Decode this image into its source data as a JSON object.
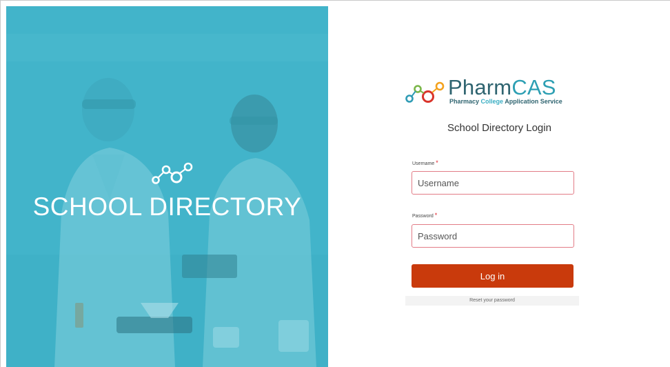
{
  "hero": {
    "title": "SCHOOL DIRECTORY",
    "logo_icon": "molecule-icon"
  },
  "brand": {
    "name_part1": "Pharm",
    "name_part2": "CAS",
    "tagline_part1": "Pharmacy ",
    "tagline_part2": "College",
    "tagline_part3": " Application Service",
    "logo_icon": "molecule-icon",
    "colors": {
      "ring_orange": "#f4a21d",
      "ring_green": "#7ab648",
      "ring_red": "#d9342b",
      "ring_teal": "#2f9cb5"
    }
  },
  "login": {
    "heading": "School Directory Login",
    "username": {
      "label": "Username",
      "required_marker": "*",
      "placeholder": "Username",
      "value": ""
    },
    "password": {
      "label": "Password",
      "required_marker": "*",
      "placeholder": "Password",
      "value": ""
    },
    "submit_label": "Log in",
    "reset_link": "Reset your password"
  },
  "colors": {
    "hero_tint": "#45b6cb",
    "button": "#c93a0c",
    "field_border": "#e27b86",
    "required": "#e0202a"
  }
}
